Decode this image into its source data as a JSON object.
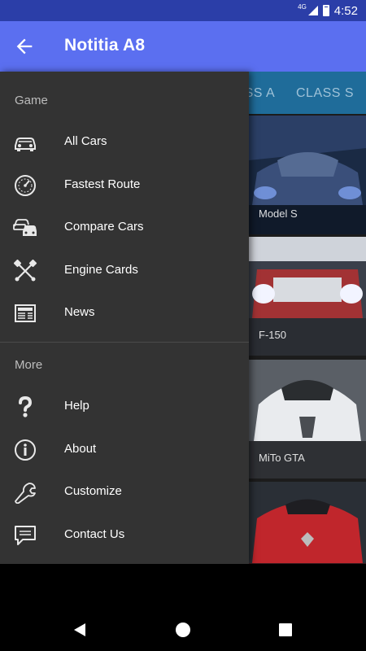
{
  "status_bar": {
    "network": "4G",
    "time": "4:52"
  },
  "app_bar": {
    "back_icon": "arrow-left-icon",
    "title": "Notitia A8"
  },
  "tabs": [
    {
      "label": "CLASS A"
    },
    {
      "label": "CLASS S"
    }
  ],
  "car_cards": [
    {
      "name": "Model S"
    },
    {
      "name": "F-150"
    },
    {
      "name": "MiTo GTA"
    },
    {
      "name": ""
    }
  ],
  "drawer": {
    "sections": [
      {
        "header": "Game",
        "items": [
          {
            "label": "All Cars",
            "icon": "car-icon"
          },
          {
            "label": "Fastest Route",
            "icon": "speedometer-icon"
          },
          {
            "label": "Compare Cars",
            "icon": "two-cars-icon"
          },
          {
            "label": "Engine Cards",
            "icon": "crossed-pistons-icon"
          },
          {
            "label": "News",
            "icon": "newspaper-icon"
          }
        ]
      },
      {
        "header": "More",
        "items": [
          {
            "label": "Help",
            "icon": "question-mark-icon"
          },
          {
            "label": "About",
            "icon": "info-icon"
          },
          {
            "label": "Customize",
            "icon": "wrench-icon"
          },
          {
            "label": "Contact Us",
            "icon": "chat-bubble-icon"
          }
        ]
      }
    ]
  },
  "colors": {
    "status_bar": "#2b3ea8",
    "app_bar": "#5b6ff0",
    "drawer_bg": "#333333",
    "tab_bar": "#1f6c9a"
  },
  "nav_bar": {
    "back": "triangle-back-icon",
    "home": "circle-home-icon",
    "recents": "square-recents-icon"
  }
}
